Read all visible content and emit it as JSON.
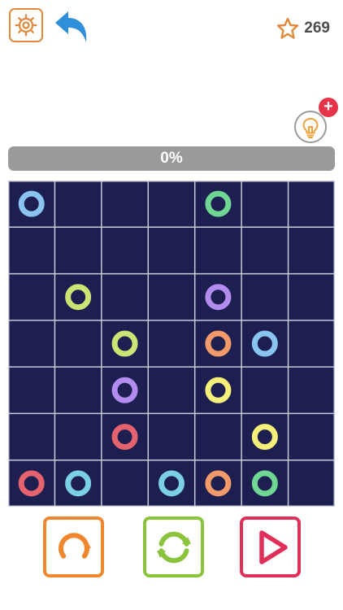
{
  "header": {
    "settings_icon": "gear-icon",
    "undo_icon": "undo-arrow-icon",
    "star_icon": "star-icon",
    "score": "269"
  },
  "hint": {
    "icon": "lightbulb-icon",
    "badge": "+"
  },
  "progress": {
    "label": "0%",
    "value": 0
  },
  "board": {
    "rows": 7,
    "cols": 7,
    "background": "#1c1f4f",
    "grid_line": "#c9cbd8",
    "dots": [
      {
        "row": 0,
        "col": 0,
        "color": "#8ac4f0"
      },
      {
        "row": 0,
        "col": 4,
        "color": "#6fd693"
      },
      {
        "row": 2,
        "col": 1,
        "color": "#cbe474"
      },
      {
        "row": 2,
        "col": 4,
        "color": "#b48cf0"
      },
      {
        "row": 3,
        "col": 2,
        "color": "#cbe474"
      },
      {
        "row": 3,
        "col": 4,
        "color": "#f29a6a"
      },
      {
        "row": 3,
        "col": 5,
        "color": "#8ac4f0"
      },
      {
        "row": 4,
        "col": 2,
        "color": "#b48cf0"
      },
      {
        "row": 4,
        "col": 4,
        "color": "#f6ef7a"
      },
      {
        "row": 5,
        "col": 2,
        "color": "#e5636e"
      },
      {
        "row": 5,
        "col": 5,
        "color": "#f6ef7a"
      },
      {
        "row": 6,
        "col": 0,
        "color": "#e5636e"
      },
      {
        "row": 6,
        "col": 1,
        "color": "#7cd0e6"
      },
      {
        "row": 6,
        "col": 3,
        "color": "#7cd0e6"
      },
      {
        "row": 6,
        "col": 4,
        "color": "#f29a6a"
      },
      {
        "row": 6,
        "col": 5,
        "color": "#6fd693"
      }
    ]
  },
  "controls": {
    "reset_icon": "reset-icon",
    "shuffle_icon": "shuffle-icon",
    "play_icon": "play-icon",
    "reset_color": "#f0872f",
    "shuffle_color": "#8ac43d",
    "play_color": "#e0305a"
  },
  "colors": {
    "settings": "#e0893a",
    "undo": "#2f8fd8",
    "star": "#e0893a",
    "hint_bulb": "#f0a23a",
    "badge": "#e8344a"
  }
}
